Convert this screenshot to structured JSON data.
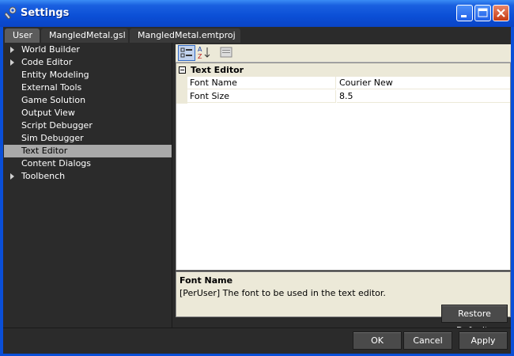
{
  "window": {
    "title": "Settings",
    "icon": "wrench-icon"
  },
  "tabs": [
    {
      "label": "User",
      "active": true
    },
    {
      "label": "MangledMetal.gsl",
      "active": false
    },
    {
      "label": "MangledMetal.emtproj",
      "active": false
    }
  ],
  "tree": {
    "items": [
      {
        "label": "World Builder",
        "expandable": true,
        "selected": false
      },
      {
        "label": "Code Editor",
        "expandable": true,
        "selected": false
      },
      {
        "label": "Entity Modeling",
        "expandable": false,
        "selected": false
      },
      {
        "label": "External Tools",
        "expandable": false,
        "selected": false
      },
      {
        "label": "Game Solution",
        "expandable": false,
        "selected": false
      },
      {
        "label": "Output View",
        "expandable": false,
        "selected": false
      },
      {
        "label": "Script Debugger",
        "expandable": false,
        "selected": false
      },
      {
        "label": "Sim Debugger",
        "expandable": false,
        "selected": false
      },
      {
        "label": "Text Editor",
        "expandable": false,
        "selected": true
      },
      {
        "label": "Content Dialogs",
        "expandable": false,
        "selected": false
      },
      {
        "label": "Toolbench",
        "expandable": true,
        "selected": false
      }
    ]
  },
  "property_grid": {
    "category": "Text Editor",
    "rows": [
      {
        "name": "Font Name",
        "value": "Courier New"
      },
      {
        "name": "Font Size",
        "value": "8.5"
      }
    ]
  },
  "description": {
    "title": "Font Name",
    "text": "[PerUser] The font to be used in the text editor."
  },
  "buttons": {
    "restore_defaults": "Restore Defaults",
    "ok": "OK",
    "cancel": "Cancel",
    "apply": "Apply"
  },
  "colors": {
    "titlebar": "#0a4fd8",
    "panel": "#2b2b2b",
    "selected_item": "#a9a9a9",
    "grid_category": "#ece9d8"
  }
}
